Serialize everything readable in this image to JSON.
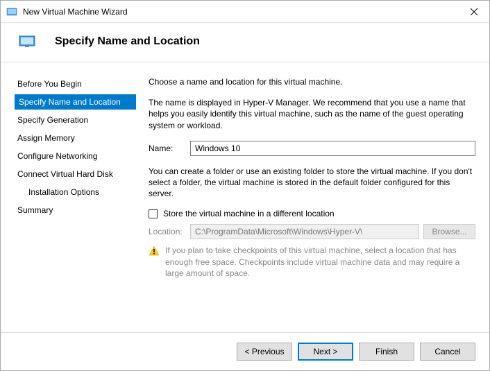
{
  "titlebar": {
    "title": "New Virtual Machine Wizard"
  },
  "header": {
    "title": "Specify Name and Location"
  },
  "sidebar": {
    "items": [
      {
        "label": "Before You Begin"
      },
      {
        "label": "Specify Name and Location"
      },
      {
        "label": "Specify Generation"
      },
      {
        "label": "Assign Memory"
      },
      {
        "label": "Configure Networking"
      },
      {
        "label": "Connect Virtual Hard Disk"
      },
      {
        "label": "Installation Options"
      },
      {
        "label": "Summary"
      }
    ]
  },
  "content": {
    "intro": "Choose a name and location for this virtual machine.",
    "name_help": "The name is displayed in Hyper-V Manager. We recommend that you use a name that helps you easily identify this virtual machine, such as the name of the guest operating system or workload.",
    "name_label": "Name:",
    "name_value": "Windows 10",
    "folder_help": "You can create a folder or use an existing folder to store the virtual machine. If you don't select a folder, the virtual machine is stored in the default folder configured for this server.",
    "checkbox_label": "Store the virtual machine in a different location",
    "location_label": "Location:",
    "location_value": "C:\\ProgramData\\Microsoft\\Windows\\Hyper-V\\",
    "browse_label": "Browse...",
    "warning_text": "If you plan to take checkpoints of this virtual machine, select a location that has enough free space. Checkpoints include virtual machine data and may require a large amount of space."
  },
  "footer": {
    "previous": "< Previous",
    "next": "Next >",
    "finish": "Finish",
    "cancel": "Cancel"
  }
}
